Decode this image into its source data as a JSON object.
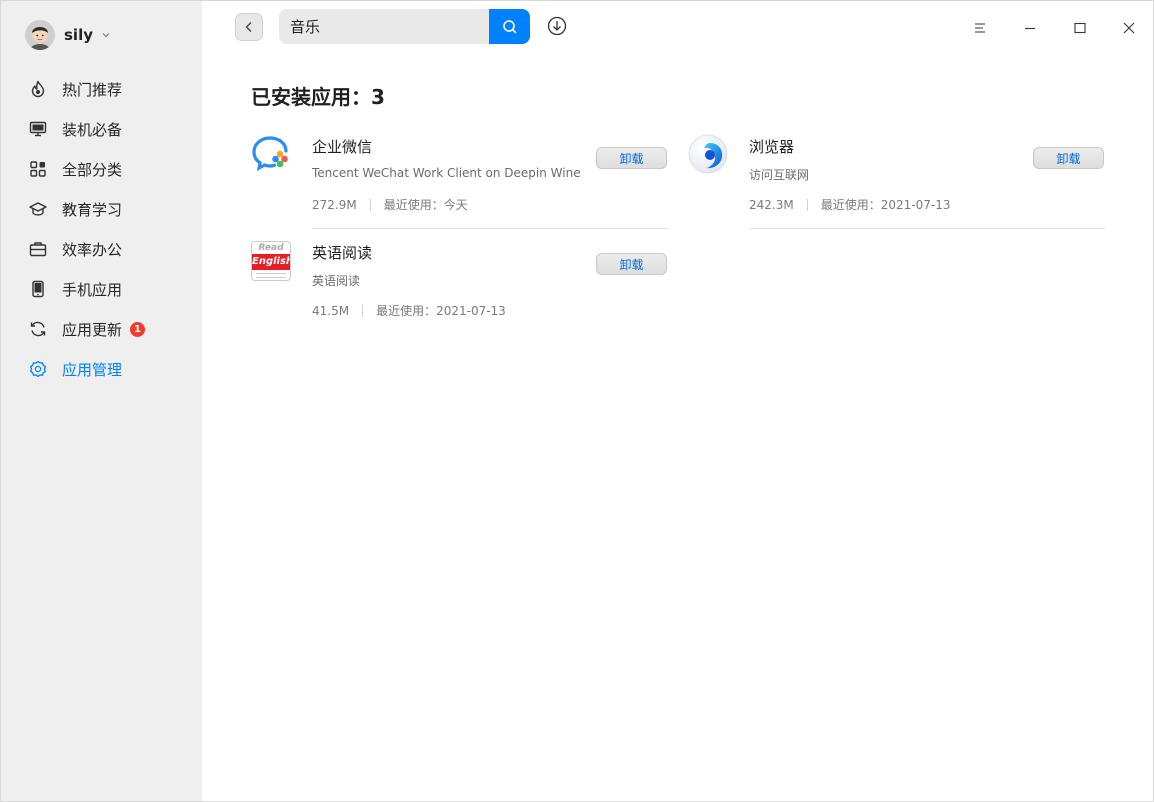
{
  "user": {
    "name": "sily"
  },
  "nav": {
    "items": [
      {
        "label": "热门推荐",
        "icon": "flame-icon"
      },
      {
        "label": "装机必备",
        "icon": "monitor-icon"
      },
      {
        "label": "全部分类",
        "icon": "grid-icon"
      },
      {
        "label": "教育学习",
        "icon": "graduation-cap-icon"
      },
      {
        "label": "效率办公",
        "icon": "briefcase-icon"
      },
      {
        "label": "手机应用",
        "icon": "phone-icon"
      },
      {
        "label": "应用更新",
        "icon": "refresh-icon",
        "badge": "1"
      },
      {
        "label": "应用管理",
        "icon": "gear-icon",
        "active": true
      }
    ]
  },
  "search": {
    "value": "音乐"
  },
  "main": {
    "title": "已安装应用：3",
    "apps": [
      {
        "name": "企业微信",
        "desc": "Tencent WeChat Work Client on Deepin Wine",
        "size": "272.9M",
        "last_used": "最近使用：今天",
        "button": "卸载"
      },
      {
        "name": "浏览器",
        "desc": "访问互联网",
        "size": "242.3M",
        "last_used": "最近使用：2021-07-13",
        "button": "卸载"
      },
      {
        "name": "英语阅读",
        "desc": "英语阅读",
        "size": "41.5M",
        "last_used": "最近使用：2021-07-13",
        "button": "卸载",
        "icon_text_top": "Read",
        "icon_text_main": "English"
      }
    ]
  },
  "colors": {
    "accent": "#0081ff",
    "badge": "#f13b2c",
    "sidebar": "#efefef"
  }
}
